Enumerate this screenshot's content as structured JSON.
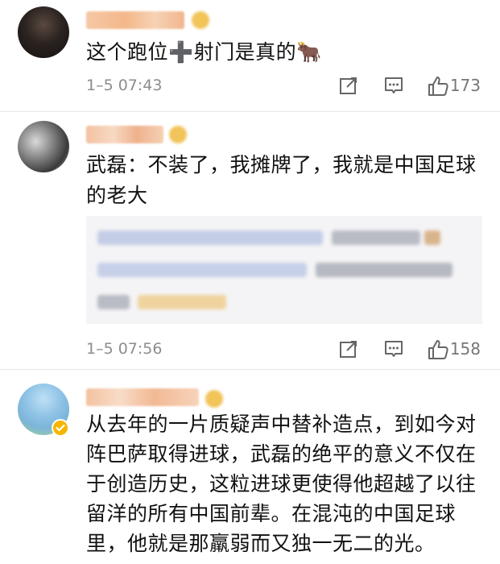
{
  "comments": [
    {
      "text": "这个跑位➕射门是真的🐂",
      "time": "1–5 07:43",
      "likes": "173",
      "icons": [
        "share-icon",
        "comment-icon",
        "like-icon"
      ]
    },
    {
      "text": "武磊：不装了，我摊牌了，我就是中国足球\n的老大",
      "time": "1–5 07:56",
      "likes": "158",
      "icons": [
        "share-icon",
        "comment-icon",
        "like-icon"
      ]
    },
    {
      "text": "从去年的一片质疑声中替补造点，到如今对\n阵巴萨取得进球，武磊的绝平的意义不仅在\n于创造历史，这粒进球更使得他超越了以往\n留洋的所有中国前辈。在混沌的中国足球\n里，他就是那羸弱而又独一无二的光。"
    }
  ]
}
